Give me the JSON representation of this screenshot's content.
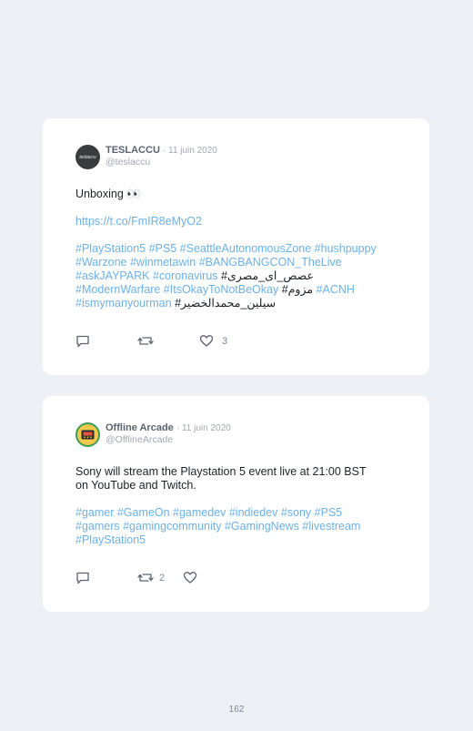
{
  "tweet1": {
    "avatar_text": "teslaccu",
    "name": "TESLACCU",
    "date": "· 11 juin 2020",
    "handle": "@teslaccu",
    "text": "Unboxing 👀",
    "link": "https://t.co/FmIR8eMyO2",
    "hashtags_line1": "#PlayStation5 #PS5 #SeattleAutonomousZone #hushpuppy",
    "hashtags_line2": "#Warzone #winmetawin #BANGBANGCON_TheLive",
    "hashtags_line3_a": "#askJAYPARK #coronavirus ",
    "hashtags_line3_b": "#عصص_ای_مصری",
    "hashtags_line4_a": "#ModernWarfare #ItsOkayToNotBeOkay ",
    "hashtags_line4_b": "#مزوم ",
    "hashtags_line4_c": "#ACNH",
    "hashtags_line5_a": "#ismymanyourman ",
    "hashtags_line5_b": "#سيلين_محمدالخضير",
    "reply_count": "",
    "retweet_count": "",
    "like_count": "3"
  },
  "tweet2": {
    "name": "Offline Arcade",
    "date": "· 11 juin 2020",
    "handle": "@OfflineArcade",
    "text_line1": "Sony will stream the Playstation 5 event live at 21:00 BST",
    "text_line2": "on YouTube and Twitch.",
    "hashtags_line1": "#gamer #GameOn #gamedev #indiedev #sony #PS5",
    "hashtags_line2": "#gamers #gamingcommunity #GamingNews #livestream",
    "hashtags_line3": "#PlayStation5",
    "reply_count": "",
    "retweet_count": "2",
    "like_count": ""
  },
  "page_number": "162",
  "colors": {
    "background": "#edf0f4",
    "card": "#ffffff",
    "link": "#6cb0e6",
    "muted": "#a1a8b1"
  }
}
